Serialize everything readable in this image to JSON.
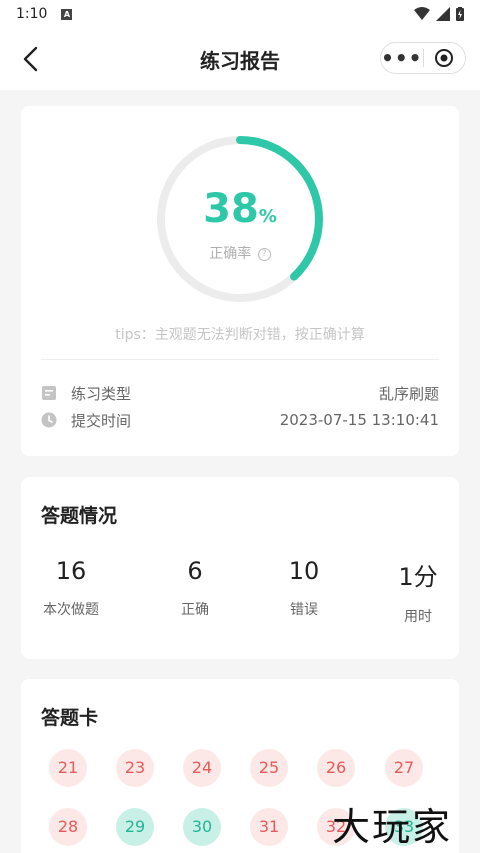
{
  "status": {
    "time": "1:10",
    "notify_icon": "A"
  },
  "nav": {
    "title": "练习报告",
    "more_label": "•••"
  },
  "report": {
    "accuracy_percent": 38,
    "accuracy_number": "38",
    "accuracy_sign": "%",
    "accuracy_label": "正确率",
    "help_icon_text": "?",
    "tips": "tips：主观题无法判断对错，按正确计算",
    "practice_type_label": "练习类型",
    "practice_type_value": "乱序刷题",
    "submit_time_label": "提交时间",
    "submit_time_value": "2023-07-15 13:10:41"
  },
  "summary": {
    "title": "答题情况",
    "stats": [
      {
        "value": "16",
        "label": "本次做题"
      },
      {
        "value": "6",
        "label": "正确"
      },
      {
        "value": "10",
        "label": "错误"
      },
      {
        "value": "1分",
        "label": "用时"
      }
    ]
  },
  "answer_card": {
    "title": "答题卡",
    "items": [
      {
        "number": "21",
        "status": "wrong"
      },
      {
        "number": "23",
        "status": "wrong"
      },
      {
        "number": "24",
        "status": "wrong"
      },
      {
        "number": "25",
        "status": "wrong"
      },
      {
        "number": "26",
        "status": "wrong"
      },
      {
        "number": "27",
        "status": "wrong"
      },
      {
        "number": "28",
        "status": "wrong"
      },
      {
        "number": "29",
        "status": "right"
      },
      {
        "number": "30",
        "status": "right"
      },
      {
        "number": "31",
        "status": "wrong"
      },
      {
        "number": "32",
        "status": "wrong"
      },
      {
        "number": "33",
        "status": "right"
      }
    ]
  },
  "watermark": "大玩家",
  "colors": {
    "accent": "#2ec8a8",
    "wrong": "#e85a5a",
    "wrong_bg": "#fde8e8",
    "right_bg": "#c9f0e7",
    "ring_track": "#ececec"
  }
}
